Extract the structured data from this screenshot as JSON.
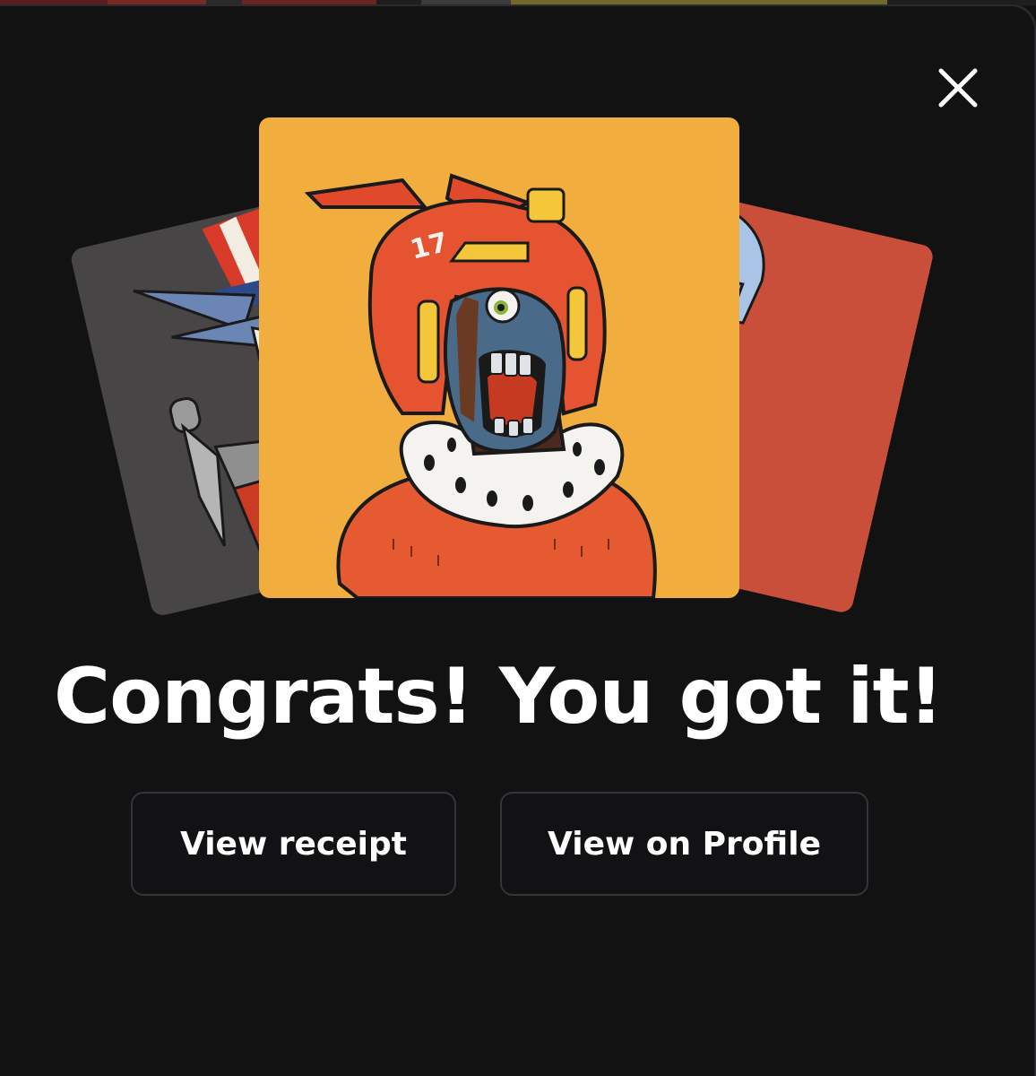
{
  "dialog": {
    "headline": "Congrats! You got it!",
    "close_icon": "close-icon"
  },
  "buttons": {
    "view_receipt": "View receipt",
    "view_on_profile": "View on Profile"
  },
  "cards": {
    "featured": {
      "background": "#f1ae3f",
      "helmet_number": "17"
    },
    "left": {
      "background": "#474545"
    },
    "right": {
      "background": "#c94f3a"
    }
  },
  "colors": {
    "modal_bg": "#121213",
    "button_border": "#34343a",
    "text": "#ffffff"
  }
}
